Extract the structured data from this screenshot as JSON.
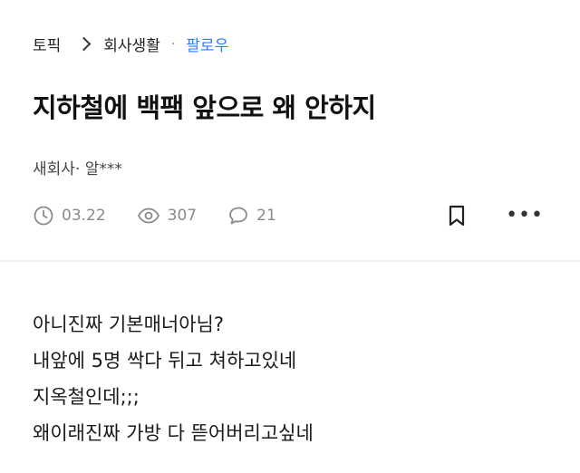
{
  "breadcrumb": {
    "topic": "토픽",
    "category": "회사생활",
    "separator": "·",
    "follow_label": "팔로우"
  },
  "post": {
    "title": "지하철에 백팩 앞으로 왜 안하지",
    "author": "새회사· 알***",
    "date": "03.22",
    "views": "307",
    "comments": "21",
    "more_label": "•••",
    "body_lines": [
      "아니진짜 기본매너아님?",
      "내앞에 5명 싹다 뒤고 쳐하고있네",
      "지옥철인데;;;",
      "왜이래진짜 가방 다 뜯어버리고싶네"
    ]
  },
  "icons": {
    "clock": "clock-icon",
    "views": "eye-icon",
    "comments": "comment-icon",
    "bookmark": "bookmark-icon",
    "more": "more-horizontal-icon",
    "breadcrumb_sep": "chevron-right-icon"
  },
  "colors": {
    "follow": "#2f7cf6",
    "meta_gray": "#8a8a8a"
  }
}
